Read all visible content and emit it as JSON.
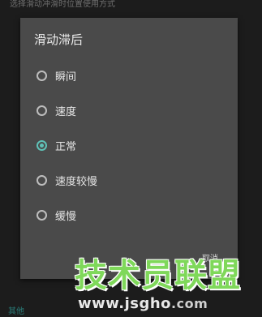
{
  "background": {
    "header_text": "选择滑动冲滑时位置使用方式",
    "link_text": "其他"
  },
  "dialog": {
    "title": "滑动滞后",
    "options": [
      {
        "label": "瞬间",
        "selected": false
      },
      {
        "label": "速度",
        "selected": false
      },
      {
        "label": "正常",
        "selected": true
      },
      {
        "label": "速度较慢",
        "selected": false
      },
      {
        "label": "缓慢",
        "selected": false
      }
    ],
    "cancel_label": "取消"
  },
  "watermark": {
    "brand": "技术员联盟",
    "url_main": "www.jsgho",
    "url_suffix": ".com"
  },
  "colors": {
    "accent": "#5fc1b7",
    "dialog_bg": "#4a4a4a",
    "screen_bg": "#1c1c1c",
    "watermark_green": "#7fd85a"
  }
}
